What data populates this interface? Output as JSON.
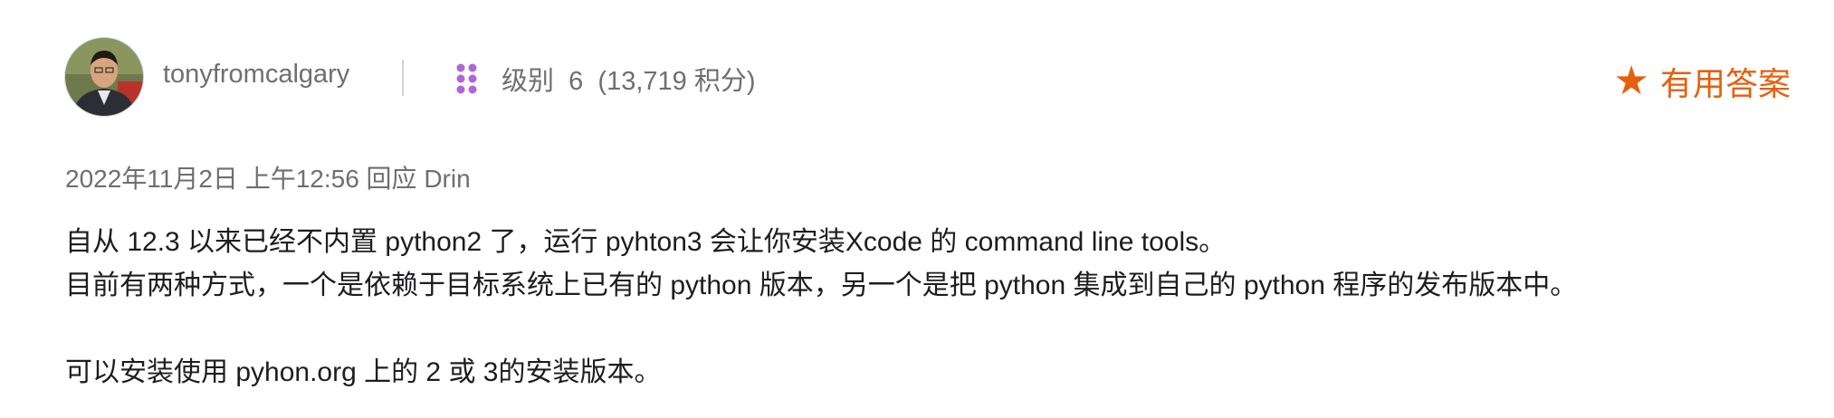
{
  "post": {
    "author": {
      "username": "tonyfromcalgary",
      "level_label": "级别",
      "level_value": "6",
      "points": "(13,719 积分)"
    },
    "badge": {
      "icon": "star-icon",
      "label": "有用答案",
      "color": "#e4600e"
    },
    "meta": "2022年11月2日 上午12:56 回应 Drin",
    "body": {
      "line1": "自从 12.3 以来已经不内置 python2 了，运行 pyhton3 会让你安装Xcode 的 command line tools。",
      "line2": "目前有两种方式，一个是依赖于目标系统上已有的 python 版本，另一个是把 python 集成到自己的 python 程序的发布版本中。",
      "line3": "可以安装使用 pyhon.org 上的 2 或 3的安装版本。"
    }
  },
  "colors": {
    "accent": "#e4600e",
    "secondary_text": "#6e6e73",
    "level_dots": "#b066d6"
  }
}
